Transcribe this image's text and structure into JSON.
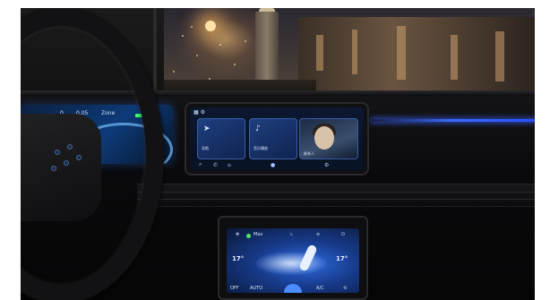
{
  "scene": {
    "subject": "car-interior-night-city",
    "accent_color": "#3b6bff",
    "ambient_light_color": "#2a4fff"
  },
  "cluster": {
    "left_readout": "0",
    "mid_readout": "0.05",
    "right_readout": "Zone"
  },
  "center_screen": {
    "cards": [
      {
        "icon": "navigation-icon",
        "label": "导航"
      },
      {
        "icon": "music-icon",
        "label": "音乐播放"
      },
      {
        "icon": "contact-icon",
        "label": "联系人"
      }
    ]
  },
  "climate": {
    "left_temp": "17°",
    "right_temp": "17°",
    "status": "Max",
    "bottom_left": "OFF",
    "bottom_auto": "AUTO",
    "bottom_ac": "A/C"
  }
}
